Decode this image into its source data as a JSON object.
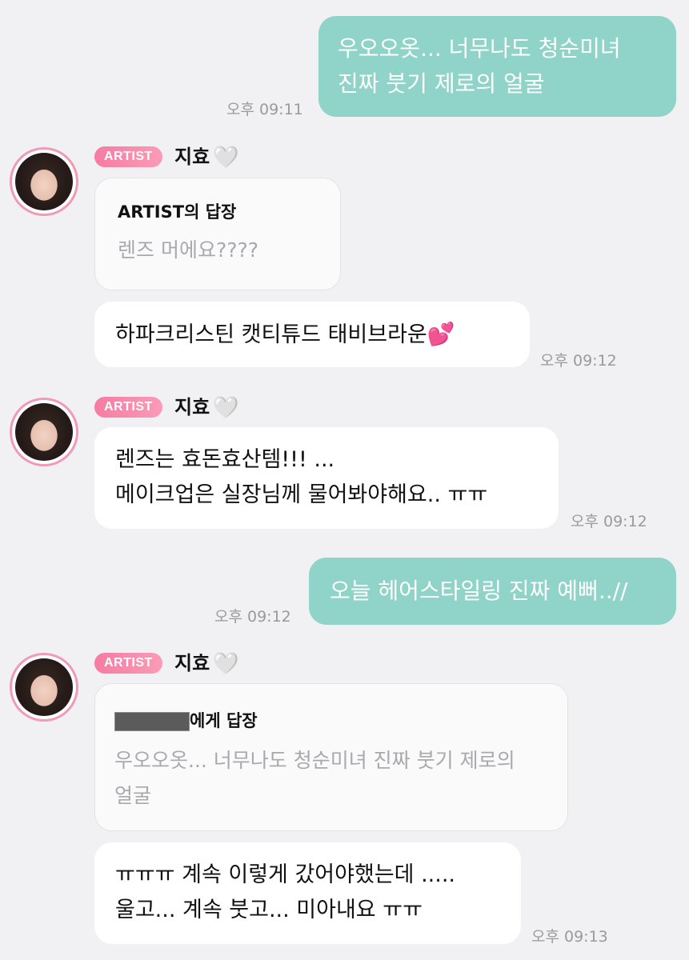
{
  "messages": {
    "m1": {
      "lines": [
        "우오오옷... 너무나도 청순미녀",
        "진짜 붓기 제로의 얼굴"
      ],
      "time": "오후 09:11"
    },
    "g1": {
      "badge": "ARTIST",
      "name": "지효",
      "name_heart": "🤍",
      "reply_title": "ARTIST의 답장",
      "reply_quote": "렌즈 머에요????",
      "text": "하파크리스틴 캣티튜드 태비브라운",
      "emoji": "💕",
      "time": "오후 09:12"
    },
    "g2": {
      "badge": "ARTIST",
      "name": "지효",
      "name_heart": "🤍",
      "lines": [
        "렌즈는 효돈효산템!!! ...",
        "메이크업은 실장님께 물어봐야해요.. ㅠㅠ"
      ],
      "time": "오후 09:12"
    },
    "m2": {
      "text": "오늘 헤어스타일링 진짜 예뻐..//",
      "time": "오후 09:12"
    },
    "g3": {
      "badge": "ARTIST",
      "name": "지효",
      "name_heart": "🤍",
      "reply_title_suffix": "에게 답장",
      "reply_quote_lines": [
        "우오오옷... 너무나도 청순미녀 진짜 붓기 제로의",
        "얼굴"
      ],
      "lines": [
        "ㅠㅠㅠ 계속 이렇게 갔어야했는데 .....",
        "울고... 계속 붓고... 미아내요 ㅠㅠ"
      ],
      "time": "오후 09:13"
    }
  },
  "colors": {
    "my_bubble": "#8fd3c9",
    "background": "#f1f1f3",
    "artist_badge": "#f67ca2",
    "avatar_ring": "#f19ab8"
  },
  "icons": {
    "avatar": "artist-avatar",
    "heart": "white-heart-icon",
    "emoji": "two-hearts-emoji"
  }
}
